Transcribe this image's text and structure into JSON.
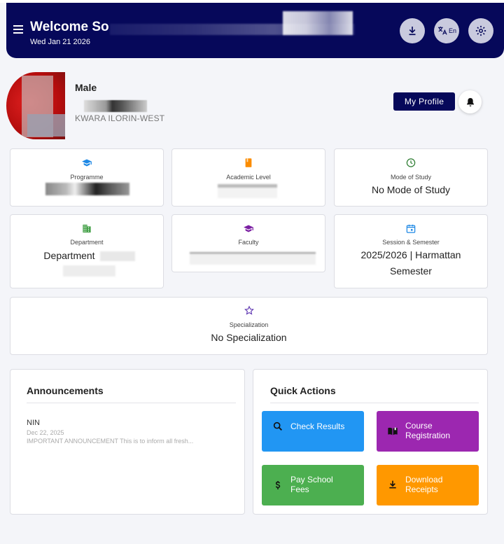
{
  "header": {
    "welcome": "Welcome So",
    "date": "Wed Jan 21 2026",
    "language": "En"
  },
  "profile": {
    "gender": "Male",
    "location": "KWARA ILORIN-WEST",
    "my_profile_label": "My Profile"
  },
  "info_cards": {
    "programme": {
      "label": "Programme",
      "value": ""
    },
    "academic_level": {
      "label": "Academic Level",
      "value": ""
    },
    "mode_of_study": {
      "label": "Mode of Study",
      "value": "No Mode of Study"
    },
    "department": {
      "label": "Department",
      "value": "Department"
    },
    "faculty": {
      "label": "Faculty",
      "value": ""
    },
    "session": {
      "label": "Session & Semester",
      "value": "2025/2026 | Harmattan Semester"
    },
    "specialization": {
      "label": "Specialization",
      "value": "No Specialization"
    }
  },
  "announcements": {
    "title": "Announcements",
    "items": [
      {
        "title": "NIN",
        "date": "Dec 22, 2025",
        "body": "IMPORTANT ANNOUNCEMENT This is to inform all fresh..."
      }
    ]
  },
  "quick_actions": {
    "title": "Quick Actions",
    "check_results": "Check Results",
    "course_registration": "Course Registration",
    "pay_fees": "Pay School Fees",
    "download_receipts": "Download Receipts"
  },
  "colors": {
    "header_bg": "#06085a",
    "check_results": "#2196f3",
    "course_registration": "#9c27b0",
    "pay_fees": "#4caf50",
    "download_receipts": "#ff9800"
  }
}
